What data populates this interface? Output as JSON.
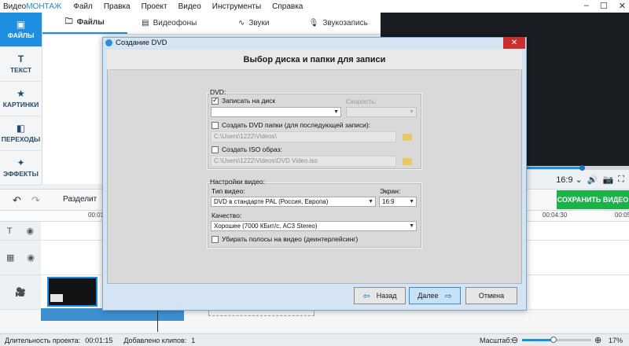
{
  "app": {
    "brand_prefix": "Видео",
    "brand_suffix": "МОНТАЖ",
    "menu": [
      "Файл",
      "Правка",
      "Проект",
      "Видео",
      "Инструменты",
      "Справка"
    ],
    "window_controls": {
      "minimize": "–",
      "maximize": "☐",
      "close": "✕"
    }
  },
  "sidebar": {
    "items": [
      {
        "label": "ФАЙЛЫ",
        "icon": "image-icon",
        "glyph": "▣",
        "active": true
      },
      {
        "label": "ТЕКСТ",
        "icon": "text-icon",
        "glyph": "T",
        "active": false
      },
      {
        "label": "КАРТИНКИ",
        "icon": "star-icon",
        "glyph": "★",
        "active": false
      },
      {
        "label": "ПЕРЕХОДЫ",
        "icon": "transition-icon",
        "glyph": "◧",
        "active": false
      },
      {
        "label": "ЭФФЕКТЫ",
        "icon": "magic-wand-icon",
        "glyph": "✦",
        "active": false
      }
    ]
  },
  "tabs": [
    {
      "label": "Файлы",
      "glyph": "🗀",
      "active": true
    },
    {
      "label": "Видеофоны",
      "glyph": "▤",
      "active": false
    },
    {
      "label": "Звуки",
      "glyph": "∿",
      "active": false
    },
    {
      "label": "Звукозапись",
      "glyph": "🎙",
      "active": false
    }
  ],
  "player": {
    "aspect": "16:9",
    "aspect_arrow": "⌄",
    "volume_glyph": "🔊",
    "snapshot_glyph": "📷",
    "fullscreen_glyph": "⛶"
  },
  "toolbar": {
    "undo_glyph": "↶",
    "redo_glyph": "↷",
    "split_label": "Разделит",
    "save_label": "СОХРАНИТЬ ВИДЕО"
  },
  "timeline": {
    "ruler_start": "00:01",
    "ruler_end": "00:04:30",
    "ruler_last": "00:05",
    "text_track_glyph": "T",
    "overlay_track_glyph": "▦",
    "video_track_glyph": "🎥",
    "eye_glyph": "◉"
  },
  "status": {
    "duration_label": "Длительность проекта:",
    "duration_value": "00:01:15",
    "clips_label": "Добавлено клипов:",
    "clips_value": "1",
    "zoom_label": "Масштаб:",
    "zoom_value": "17%",
    "zoom_minus": "⊖",
    "zoom_plus": "⊕",
    "zoom_level": 0.45
  },
  "dialog": {
    "title": "Создание DVD",
    "close_glyph": "✕",
    "heading": "Выбор диска и папки для записи",
    "dvd": {
      "group_label": "DVD:",
      "burn_label": "Записать на диск",
      "burn_checked": true,
      "burn_drive_value": "",
      "speed_label": "Скорость:",
      "create_folder_label": "Создать DVD папки (для последующей записи):",
      "create_folder_checked": false,
      "folder_path": "C:\\Users\\1222\\Videos\\",
      "create_iso_label": "Создать ISO образ:",
      "create_iso_checked": false,
      "iso_path": "C:\\Users\\1222\\Videos\\DVD Video.iso"
    },
    "video": {
      "group_label": "Настройки видео:",
      "type_label": "Тип видео:",
      "type_value": "DVD в стандарте PAL (Россия, Европа)",
      "screen_label": "Экран:",
      "screen_value": "16:9",
      "quality_label": "Качество:",
      "quality_value": "Хорошее (7000 КБит/с, AC3 Stereo)",
      "deinterlace_label": "Убирать полосы на видео (деинтерлейсинг)",
      "deinterlace_checked": false
    },
    "buttons": {
      "back_label": "Назад",
      "next_label": "Далее",
      "cancel_label": "Отмена"
    }
  }
}
